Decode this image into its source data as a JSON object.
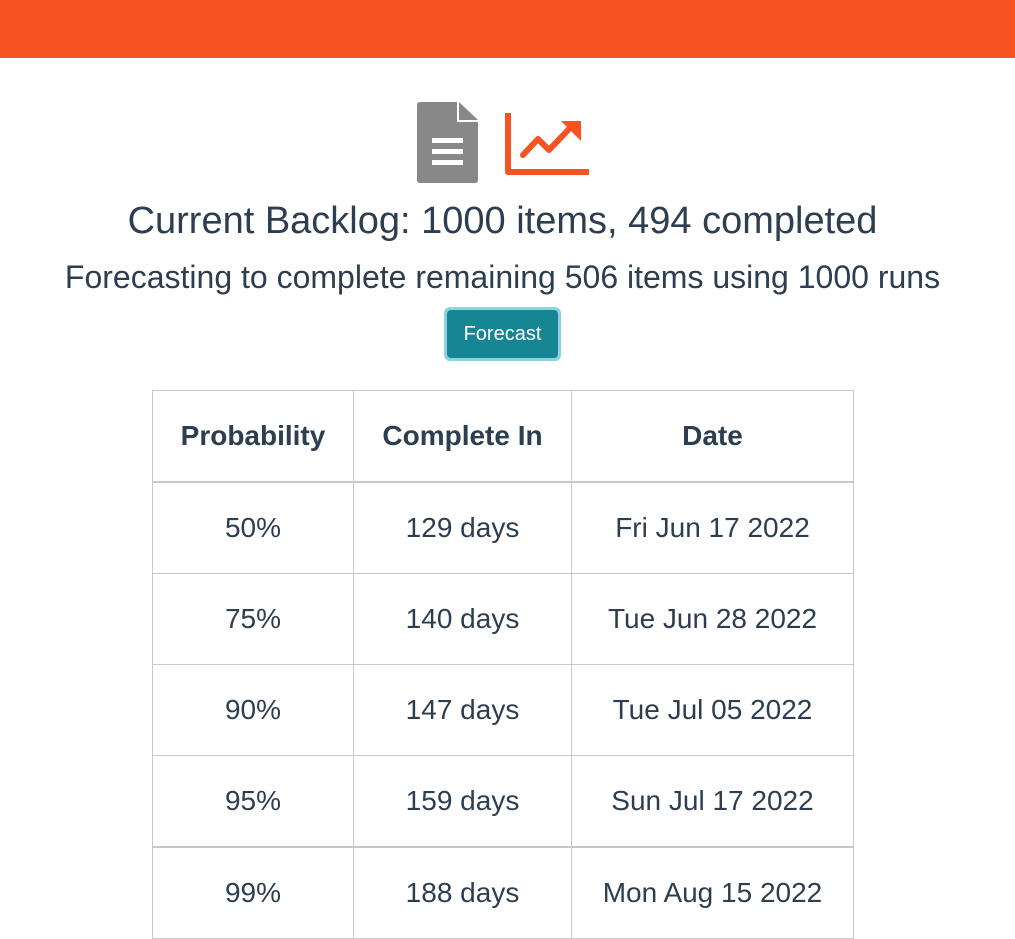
{
  "colors": {
    "accent": "#f65322",
    "button_bg": "#168594",
    "button_ring": "#8fd1dd",
    "text": "#2c3e50",
    "doc_icon": "#888888"
  },
  "icons": {
    "document": "document-icon",
    "trend": "trending-up-icon"
  },
  "header": {
    "title": "Current Backlog: 1000 items, 494 completed",
    "subtitle": "Forecasting to complete remaining 506 items using 1000 runs"
  },
  "forecast_button": {
    "label": "Forecast"
  },
  "results_table": {
    "columns": [
      "Probability",
      "Complete In",
      "Date"
    ],
    "rows": [
      [
        "50%",
        "129 days",
        "Fri Jun 17 2022"
      ],
      [
        "75%",
        "140 days",
        "Tue Jun 28 2022"
      ],
      [
        "90%",
        "147 days",
        "Tue Jul 05 2022"
      ],
      [
        "95%",
        "159 days",
        "Sun Jul 17 2022"
      ],
      [
        "99%",
        "188 days",
        "Mon Aug 15 2022"
      ]
    ]
  }
}
